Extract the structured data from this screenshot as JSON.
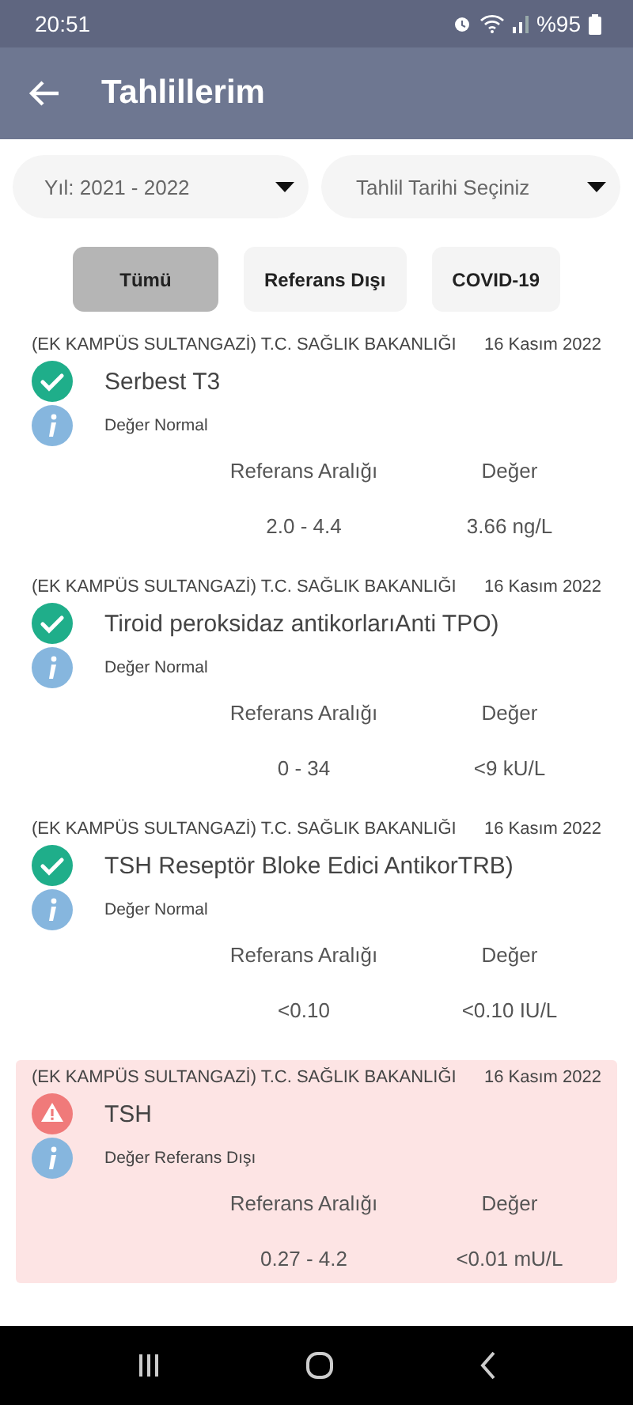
{
  "status_bar": {
    "time": "20:51",
    "battery": "%95"
  },
  "app_bar": {
    "title": "Tahlillerim"
  },
  "filters": [
    {
      "label": "Yıl: 2021 - 2022"
    },
    {
      "label": "Tahlil Tarihi Seçiniz"
    }
  ],
  "tabs": [
    {
      "label": "Tümü",
      "selected": true
    },
    {
      "label": "Referans Dışı",
      "selected": false
    },
    {
      "label": "COVID-19",
      "selected": false
    }
  ],
  "results": [
    {
      "kind": "normal",
      "institution": "(EK KAMPÜS SULTANGAZİ) T.C. SAĞLIK BAKANLIĞI",
      "date": "16 Kasım 2022",
      "test": "Serbest T3",
      "status": "Değer Normal",
      "range_label": "Referans Aralığı",
      "value_label": "Değer",
      "range": "2.0 - 4.4",
      "value": "3.66 ng/L"
    },
    {
      "kind": "normal",
      "institution": "(EK KAMPÜS SULTANGAZİ) T.C. SAĞLIK BAKANLIĞI",
      "date": "16 Kasım 2022",
      "test": "Tiroid peroksidaz antikorlarıAnti TPO)",
      "status": "Değer Normal",
      "range_label": "Referans Aralığı",
      "value_label": "Değer",
      "range": "0 - 34",
      "value": "<9 kU/L"
    },
    {
      "kind": "normal",
      "institution": "(EK KAMPÜS SULTANGAZİ) T.C. SAĞLIK BAKANLIĞI",
      "date": "16 Kasım 2022",
      "test": "TSH Reseptör Bloke Edici AntikorTRB)",
      "status": "Değer Normal",
      "range_label": "Referans Aralığı",
      "value_label": "Değer",
      "range": "<0.10",
      "value": "<0.10 IU/L"
    },
    {
      "kind": "out_of_range",
      "institution": "(EK KAMPÜS SULTANGAZİ) T.C. SAĞLIK BAKANLIĞI",
      "date": "16 Kasım 2022",
      "test": "TSH",
      "status": "Değer Referans Dışı",
      "range_label": "Referans Aralığı",
      "value_label": "Değer",
      "range": "0.27 - 4.2",
      "value": "<0.01 mU/L"
    }
  ]
}
